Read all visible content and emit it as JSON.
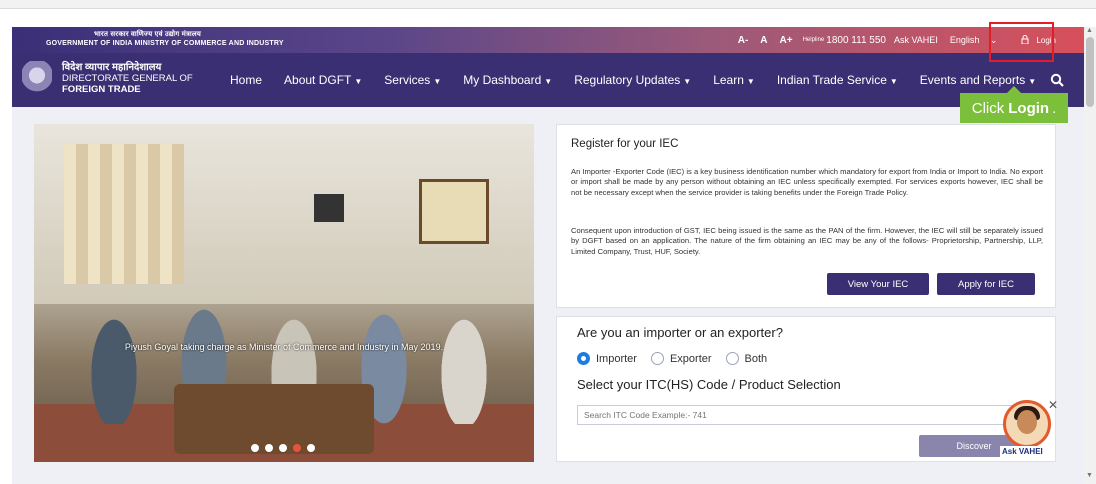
{
  "topbar": {
    "gov_hindi": "भारत सरकार  वाणिज्य एवं उद्योग मंत्रालय",
    "gov_english": "GOVERNMENT OF INDIA  MINISTRY OF COMMERCE AND INDUSTRY",
    "font_small": "A-",
    "font_normal": "A",
    "font_large": "A+",
    "helpline_label": "Helpline",
    "helpline_number": "1800 111 550",
    "ask_vahei": "Ask VAHEI",
    "language": "English",
    "login": "Login"
  },
  "nav": {
    "org_hindi": "विदेश व्यापार महानिदेशालय",
    "org_line1": "DIRECTORATE GENERAL OF",
    "org_line2": "FOREIGN TRADE",
    "items": [
      {
        "label": "Home",
        "has_caret": false
      },
      {
        "label": "About DGFT",
        "has_caret": true
      },
      {
        "label": "Services",
        "has_caret": true
      },
      {
        "label": "My Dashboard",
        "has_caret": true
      },
      {
        "label": "Regulatory Updates",
        "has_caret": true
      },
      {
        "label": "Learn",
        "has_caret": true
      },
      {
        "label": "Indian Trade Service",
        "has_caret": true
      },
      {
        "label": "Events and Reports",
        "has_caret": true
      }
    ]
  },
  "tooltip": {
    "prefix": "Click",
    "bold": "Login",
    "suffix": "."
  },
  "carousel": {
    "caption": "Piyush Goyal taking charge as Minister of Commerce and Industry in May 2019.",
    "slides": 5,
    "active_slide": 4
  },
  "iec_card": {
    "title": "Register for your IEC",
    "para1": "An Importer -Exporter Code (IEC) is a key business identification number which mandatory for export from India or Import to India. No export or import shall be made by any person without obtaining an IEC unless specifically exempted. For services exports however, IEC shall be not be necessary except when the service provider is taking benefits under the Foreign Trade Policy.",
    "para2": "Consequent upon introduction of GST, IEC being issued is the same as the PAN of the firm. However, the IEC will still be separately issued by DGFT based on an application. The nature of the firm obtaining an IEC may be any of the follows- Proprietorship, Partnership, LLP, Limited Company, Trust, HUF, Society.",
    "view_button": "View Your IEC",
    "apply_button": "Apply for IEC"
  },
  "trade_card": {
    "question": "Are you an importer or an exporter?",
    "options": [
      "Importer",
      "Exporter",
      "Both"
    ],
    "selected": "Importer",
    "select_title": "Select your ITC(HS) Code / Product Selection",
    "search_placeholder": "Search ITC Code Example:- 741",
    "discover_button": "Discover"
  },
  "chatbot": {
    "label": "Ask VAHEI"
  },
  "colors": {
    "nav_bg": "#3b2f73",
    "accent_button": "#3b2f73",
    "tooltip_bg": "#7cbf3a",
    "highlight_border": "#e21d2a",
    "radio_selected": "#1e7be0"
  }
}
